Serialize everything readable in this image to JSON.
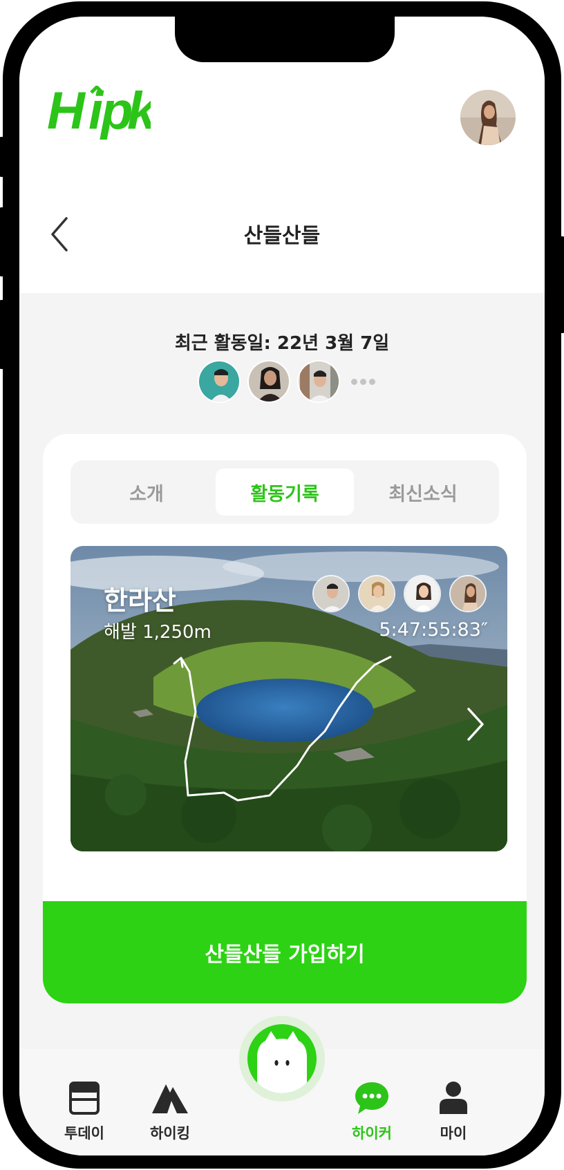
{
  "app": {
    "name": "Hipk",
    "brand_color": "#2cc418",
    "logo_icon": "hipk-logo"
  },
  "header": {
    "back_icon": "chevron-left-icon",
    "title": "산들산들"
  },
  "club": {
    "last_activity": "최근 활동일: 22년 3월 7일",
    "members_more_icon": "ellipsis-icon"
  },
  "tabs": [
    {
      "label": "소개",
      "active": false
    },
    {
      "label": "활동기록",
      "active": true
    },
    {
      "label": "최신소식",
      "active": false
    }
  ],
  "record": {
    "mountain": "한라산",
    "elevation": "해발 1,250m",
    "time": "5:47:55:83″",
    "next_icon": "chevron-right-icon"
  },
  "join_button": "산들산들 가입하기",
  "nav": {
    "items": [
      {
        "label": "투데이",
        "icon": "calendar-icon",
        "active": false
      },
      {
        "label": "하이킹",
        "icon": "mountain-icon",
        "active": false
      },
      {
        "label": "하이커",
        "icon": "chat-icon",
        "active": true
      },
      {
        "label": "마이",
        "icon": "person-icon",
        "active": false
      }
    ],
    "center_icon": "mascot-icon"
  }
}
